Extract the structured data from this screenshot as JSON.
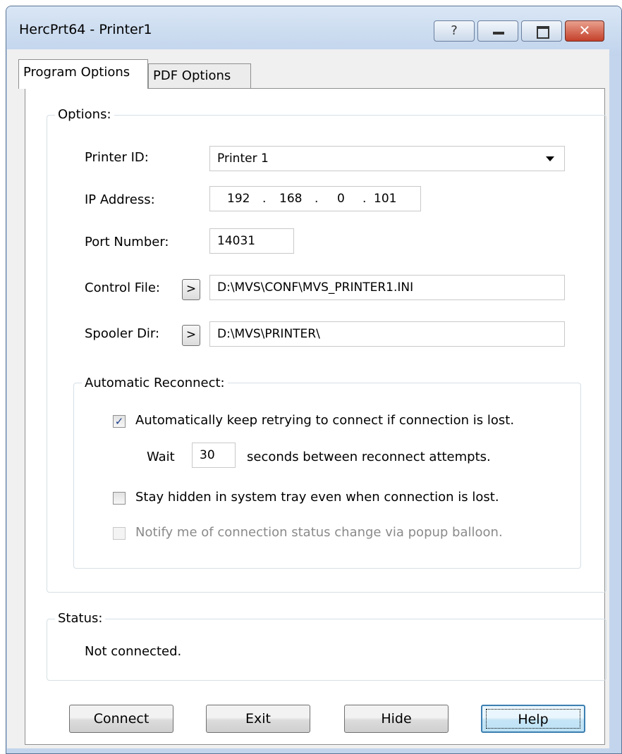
{
  "window": {
    "title": "HercPrt64  -  Printer1",
    "help_glyph": "?",
    "close_glyph": "✕"
  },
  "tabs": [
    {
      "label": "Program Options",
      "selected": true
    },
    {
      "label": "PDF Options",
      "selected": false
    }
  ],
  "options": {
    "legend": "Options:",
    "printer_id": {
      "label": "Printer ID:",
      "value": "Printer 1"
    },
    "ip_address": {
      "label": "IP Address:",
      "octets": [
        "192",
        "168",
        "0",
        "101"
      ],
      "separator": "."
    },
    "port_number": {
      "label": "Port Number:",
      "value": "14031"
    },
    "control_file": {
      "label": "Control File:",
      "browse": ">",
      "value": "D:\\MVS\\CONF\\MVS_PRINTER1.INI"
    },
    "spooler_dir": {
      "label": "Spooler Dir:",
      "browse": ">",
      "value": "D:\\MVS\\PRINTER\\"
    }
  },
  "reconnect": {
    "legend": "Automatic Reconnect:",
    "auto_retry": {
      "label": "Automatically keep retrying to connect if connection is lost.",
      "checked": true
    },
    "wait_prefix": "Wait",
    "wait_seconds": "30",
    "wait_suffix": "seconds between reconnect attempts.",
    "stay_hidden": {
      "label": "Stay hidden in system tray even when connection is lost.",
      "checked": false
    },
    "notify": {
      "label": "Notify me of connection status change via popup balloon.",
      "checked": false,
      "enabled": false
    }
  },
  "status": {
    "legend": "Status:",
    "text": "Not connected."
  },
  "buttons": {
    "connect": "Connect",
    "exit": "Exit",
    "hide": "Hide",
    "help": "Help"
  },
  "colors": {
    "frame": "#c3d5ec",
    "client": "#f0f0f0",
    "close_button": "#c4402a",
    "default_button_border": "#3c7fb1"
  }
}
